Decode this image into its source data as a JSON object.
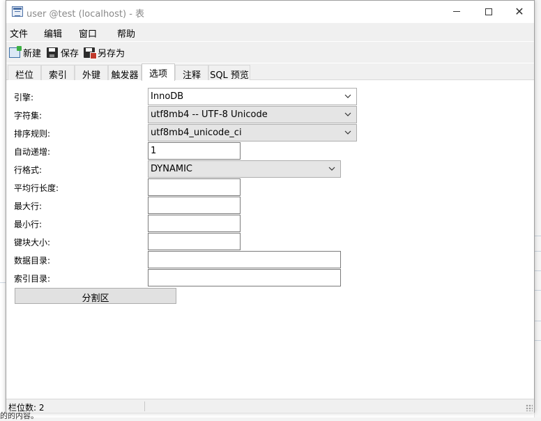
{
  "window": {
    "title": "user @test (localhost) - 表"
  },
  "menu": {
    "items": [
      "文件",
      "编辑",
      "窗口",
      "帮助"
    ]
  },
  "toolbar": {
    "new_label": "新建",
    "save_label": "保存",
    "saveas_label": "另存为"
  },
  "tabs": [
    {
      "label": "栏位",
      "active": false
    },
    {
      "label": "索引",
      "active": false
    },
    {
      "label": "外键",
      "active": false
    },
    {
      "label": "触发器",
      "active": false
    },
    {
      "label": "选项",
      "active": true
    },
    {
      "label": "注释",
      "active": false
    },
    {
      "label": "SQL 预览",
      "active": false
    }
  ],
  "options": {
    "engine": {
      "label": "引擎:",
      "value": "InnoDB"
    },
    "charset": {
      "label": "字符集:",
      "value": "utf8mb4 -- UTF-8 Unicode"
    },
    "collation": {
      "label": "排序规则:",
      "value": "utf8mb4_unicode_ci"
    },
    "auto_increment": {
      "label": "自动递增:",
      "value": "1"
    },
    "row_format": {
      "label": "行格式:",
      "value": "DYNAMIC"
    },
    "avg_row_length": {
      "label": "平均行长度:",
      "value": ""
    },
    "max_rows": {
      "label": "最大行:",
      "value": ""
    },
    "min_rows": {
      "label": "最小行:",
      "value": ""
    },
    "key_block_size": {
      "label": "键块大小:",
      "value": ""
    },
    "data_directory": {
      "label": "数据目录:",
      "value": ""
    },
    "index_directory": {
      "label": "索引目录:",
      "value": ""
    },
    "partition_button": "分割区"
  },
  "statusbar": {
    "text": "栏位数: 2"
  },
  "background": {
    "bottom_text": "的的内容。"
  },
  "colors": {
    "window_bg": "#ffffff",
    "chrome_bg": "#f0f0f0",
    "active_tab_bg": "#ffffff"
  }
}
